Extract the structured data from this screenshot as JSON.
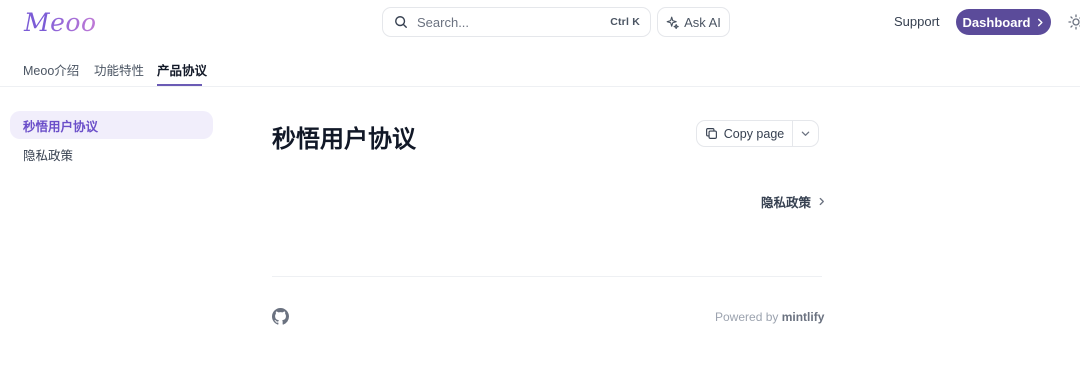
{
  "header": {
    "logo_initial": "M",
    "logo_rest": "eoo",
    "search": {
      "placeholder": "Search...",
      "shortcut": "Ctrl K"
    },
    "ask_ai_label": "Ask AI",
    "support_label": "Support",
    "dashboard_label": "Dashboard"
  },
  "tabs": [
    {
      "label": "Meoo介绍",
      "active": false
    },
    {
      "label": "功能特性",
      "active": false
    },
    {
      "label": "产品协议",
      "active": true
    }
  ],
  "sidebar": {
    "items": [
      {
        "label": "秒悟用户协议",
        "active": true
      },
      {
        "label": "隐私政策",
        "active": false
      }
    ]
  },
  "page": {
    "title": "秒悟用户协议",
    "copy_page_label": "Copy page",
    "next_link_label": "隐私政策"
  },
  "footer": {
    "powered_prefix": "Powered by",
    "powered_brand": "mintlify"
  },
  "colors": {
    "accent": "#5b4b9a",
    "sidebar_active_bg": "#f1eefb",
    "sidebar_active_text": "#6b4fc9"
  }
}
